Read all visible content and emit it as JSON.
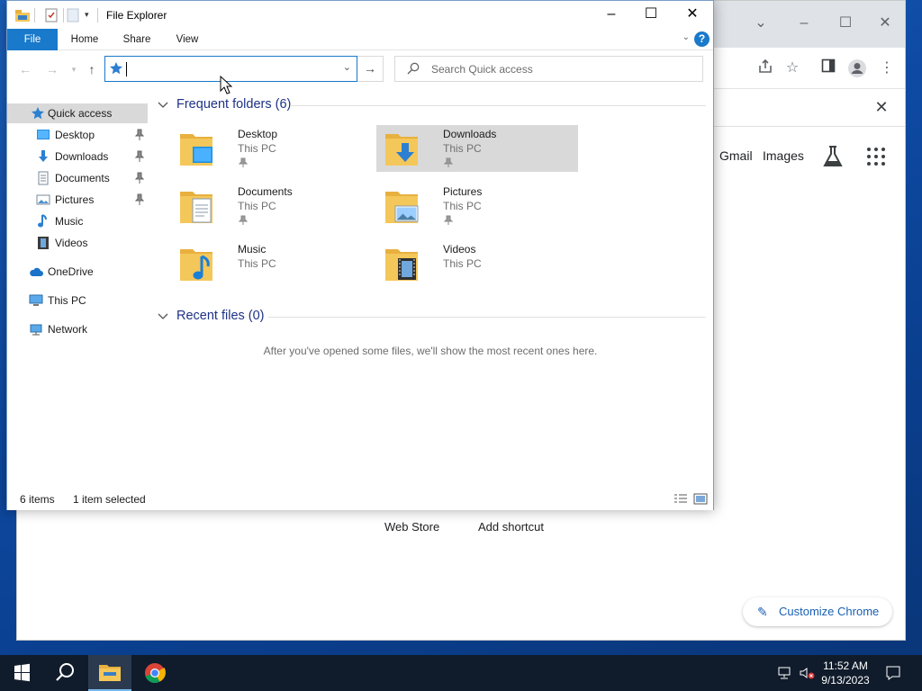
{
  "chrome": {
    "links": [
      "Gmail",
      "Images"
    ],
    "shortcuts": [
      "Web Store",
      "Add shortcut"
    ],
    "customize_label": "Customize Chrome"
  },
  "explorer": {
    "title": "File Explorer",
    "ribbon_tabs": [
      "File",
      "Home",
      "Share",
      "View"
    ],
    "address_value": "",
    "search_placeholder": "Search Quick access",
    "nav": {
      "quick_access": "Quick access",
      "pinned": [
        "Desktop",
        "Downloads",
        "Documents",
        "Pictures"
      ],
      "unpinned": [
        "Music",
        "Videos"
      ],
      "onedrive": "OneDrive",
      "this_pc": "This PC",
      "network": "Network"
    },
    "frequent_header": "Frequent folders (6)",
    "recent_header": "Recent files (0)",
    "folders": [
      {
        "name": "Desktop",
        "location": "This PC",
        "pinned": true
      },
      {
        "name": "Downloads",
        "location": "This PC",
        "pinned": true,
        "selected": true
      },
      {
        "name": "Documents",
        "location": "This PC",
        "pinned": true
      },
      {
        "name": "Pictures",
        "location": "This PC",
        "pinned": true
      },
      {
        "name": "Music",
        "location": "This PC",
        "pinned": false
      },
      {
        "name": "Videos",
        "location": "This PC",
        "pinned": false
      }
    ],
    "recent_empty_message": "After you've opened some files, we'll show the most recent ones here.",
    "status": {
      "items": "6 items",
      "selected": "1 item selected"
    }
  },
  "taskbar": {
    "time": "11:52 AM",
    "date": "9/13/2023"
  },
  "colors": {
    "accent": "#1979ca",
    "selection": "#d9d9d9",
    "group_header": "#1e3287",
    "taskbar": "#101c2c",
    "folder_yellow": "#f4c75a"
  }
}
